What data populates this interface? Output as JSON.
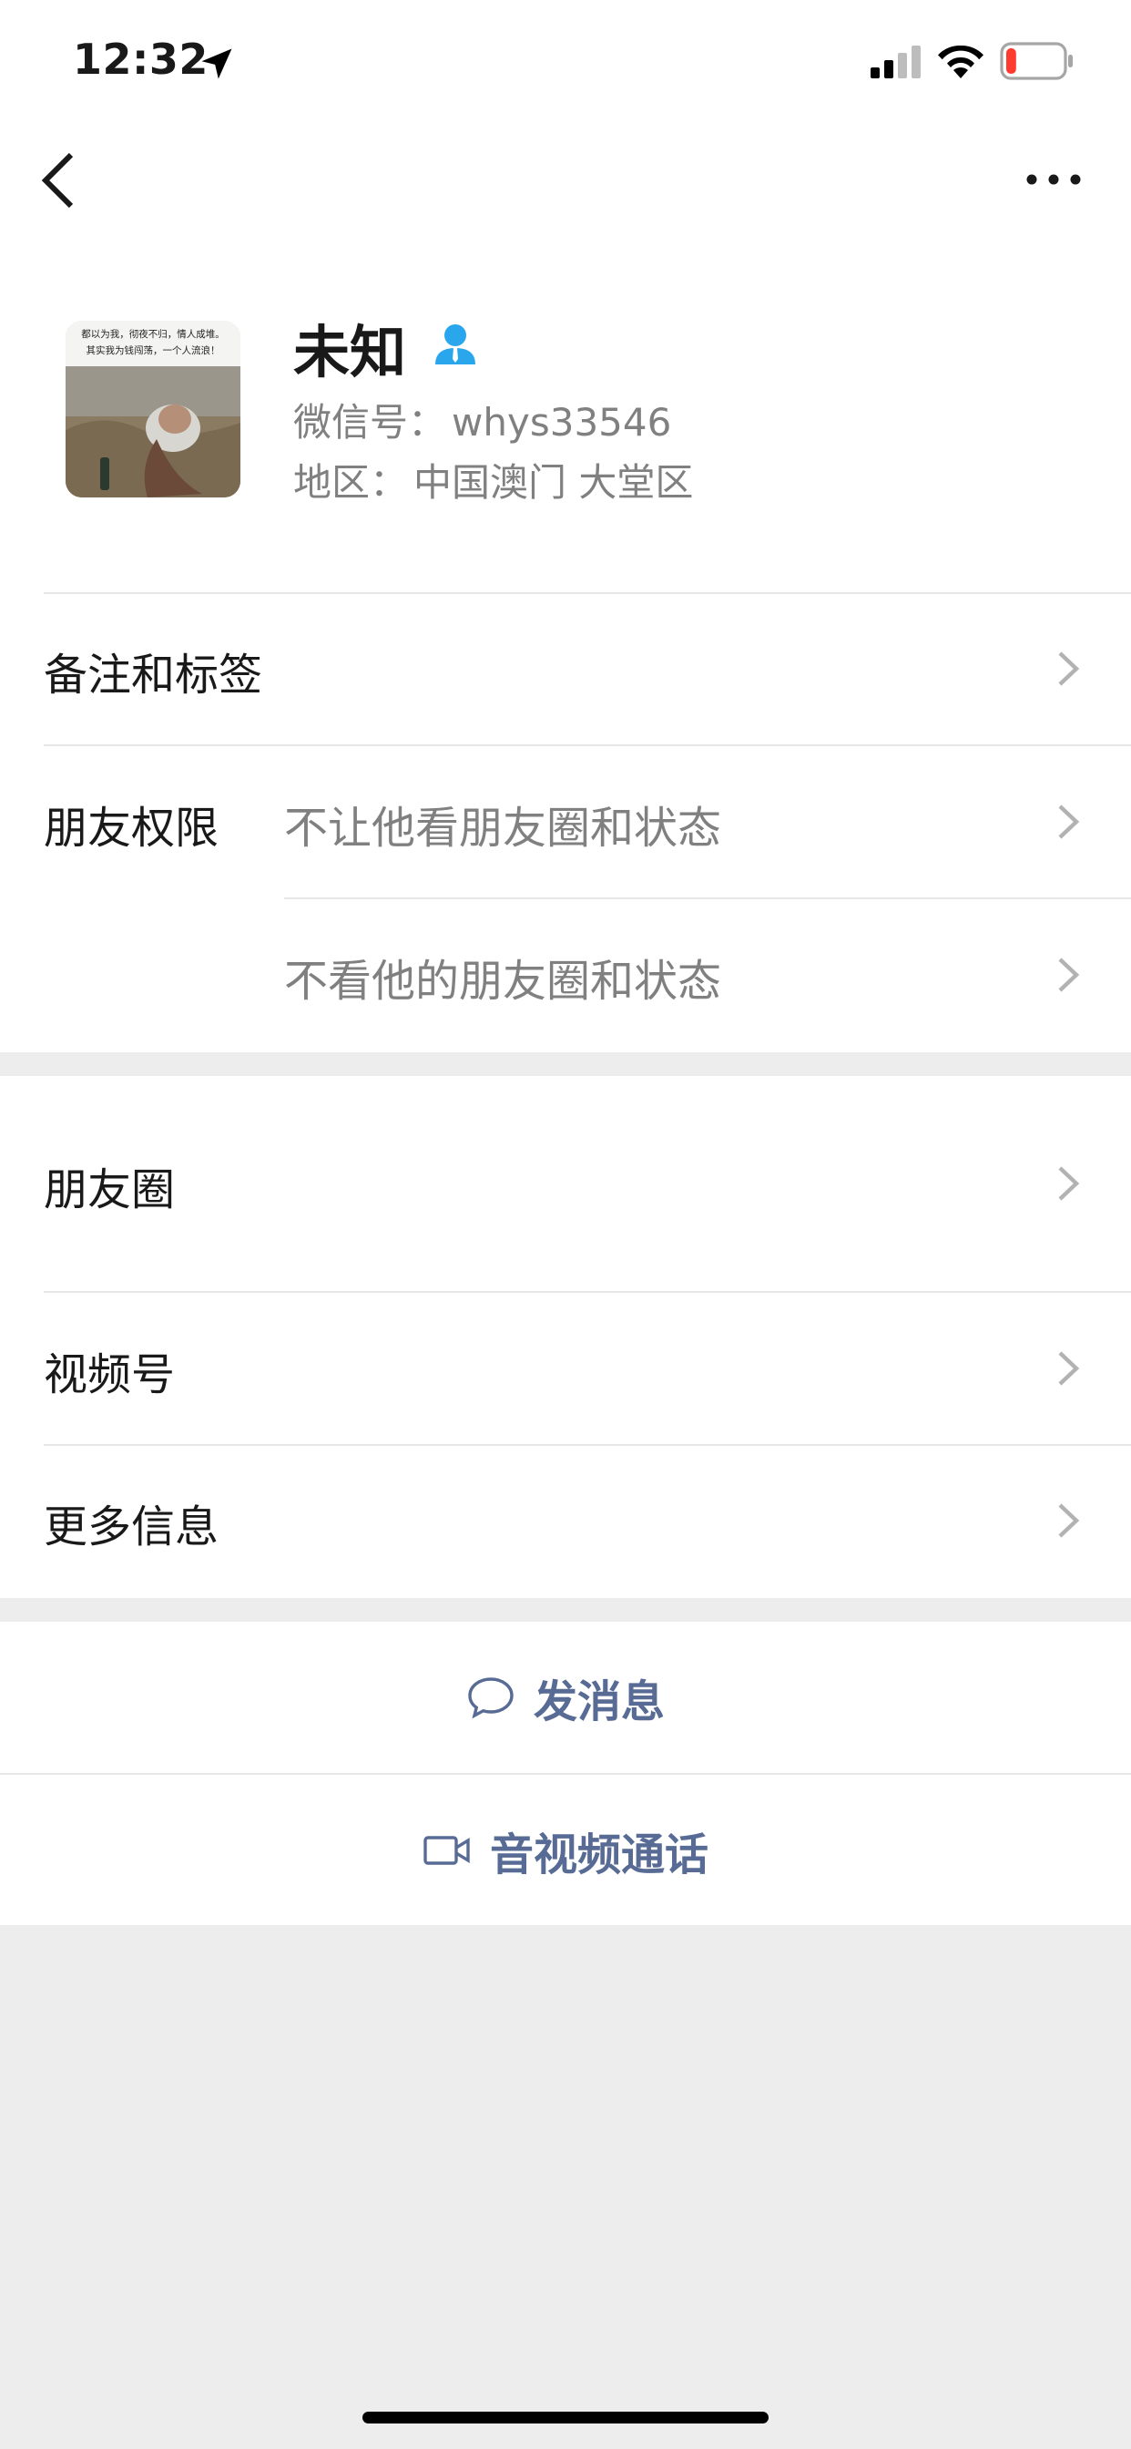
{
  "status_bar": {
    "time": "12:32",
    "battery_level": 0.18
  },
  "profile": {
    "name": "未知",
    "wechat_id_label": "微信号：",
    "wechat_id": "whys33546",
    "region_label": "地区：",
    "region": "中国澳门 大堂区",
    "avatar_caption_line1": "都以为我，彻夜不归，情人成堆。",
    "avatar_caption_line2": "其实我为钱闯荡，一个人流浪！"
  },
  "rows": {
    "remarks_tags": "备注和标签",
    "friend_permissions": "朋友权限",
    "perm_option_1": "不让他看朋友圈和状态",
    "perm_option_2": "不看他的朋友圈和状态",
    "moments": "朋友圈",
    "channels": "视频号",
    "more_info": "更多信息"
  },
  "actions": {
    "send_message": "发消息",
    "av_call": "音视频通话"
  },
  "colors": {
    "link": "#576b95",
    "accent_blue": "#2aa6ec",
    "battery_low": "#ff3b30",
    "background": "#ededed"
  },
  "icons": [
    "location-arrow-icon",
    "signal-icon",
    "wifi-icon",
    "battery-icon",
    "back-chevron-icon",
    "more-dots-icon",
    "person-icon",
    "chevron-right-icon",
    "chat-bubble-icon",
    "video-camera-icon"
  ]
}
